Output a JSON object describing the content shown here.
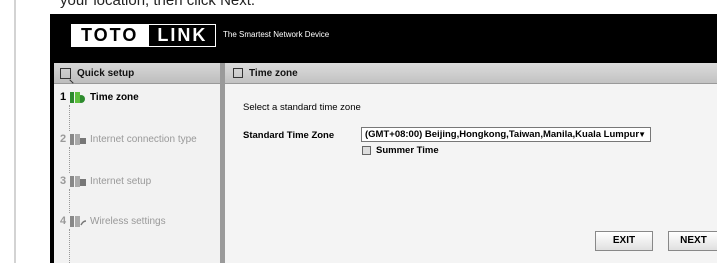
{
  "caption": "your location, then click Next.",
  "header": {
    "logo_part1": "TOTO",
    "logo_part2": "LINK",
    "tagline": "The Smartest Network Device"
  },
  "sidebar": {
    "title": "Quick setup",
    "steps": [
      {
        "number": "1",
        "label": "Time zone",
        "active": true
      },
      {
        "number": "2",
        "label": "Internet connection type",
        "active": false
      },
      {
        "number": "3",
        "label": "Internet setup",
        "active": false
      },
      {
        "number": "4",
        "label": "Wireless settings",
        "active": false
      }
    ]
  },
  "main": {
    "title": "Time zone",
    "instruction": "Select a standard time zone",
    "tz_label": "Standard Time Zone",
    "tz_value": "(GMT+08:00) Beijing,Hongkong,Taiwan,Manila,Kuala Lumpur",
    "summer_label": "Summer Time",
    "exit_label": "EXIT",
    "next_label": "NEXT"
  },
  "colors": {
    "header_bg": "#000000",
    "active_step_icon": "#2e8b2e",
    "inactive_step_icon": "#888888"
  }
}
